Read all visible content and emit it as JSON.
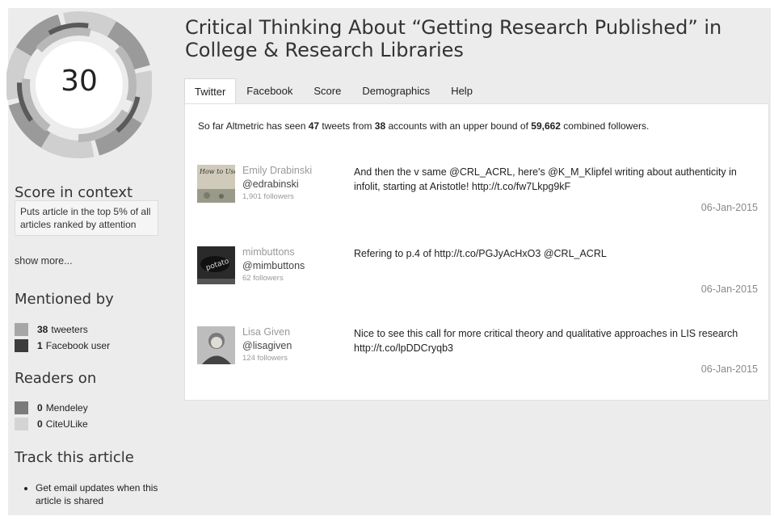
{
  "article": {
    "title": "Critical Thinking About “Getting Research Published” in College & Research Libraries"
  },
  "score": {
    "value": "30",
    "context_title": "Score in context",
    "context_text": "Puts article in the top 5% of all articles ranked by attention",
    "show_more": "show more..."
  },
  "mentioned_by": {
    "title": "Mentioned by",
    "items": [
      {
        "count": "38",
        "label": "tweeters",
        "color": "#a6a6a6"
      },
      {
        "count": "1",
        "label": "Facebook user",
        "color": "#3c3c3c"
      }
    ]
  },
  "readers_on": {
    "title": "Readers on",
    "items": [
      {
        "count": "0",
        "label": "Mendeley",
        "color": "#7a7a7a"
      },
      {
        "count": "0",
        "label": "CiteULike",
        "color": "#d4d4d4"
      }
    ]
  },
  "track": {
    "title": "Track this article",
    "items": [
      "Get email updates when this article is shared"
    ]
  },
  "tabs": [
    {
      "label": "Twitter",
      "active": true
    },
    {
      "label": "Facebook",
      "active": false
    },
    {
      "label": "Score",
      "active": false
    },
    {
      "label": "Demographics",
      "active": false
    },
    {
      "label": "Help",
      "active": false
    }
  ],
  "summary": {
    "prefix": "So far Altmetric has seen ",
    "tweets": "47",
    "mid1": " tweets from ",
    "accounts": "38",
    "mid2": " accounts with an upper bound of ",
    "followers": "59,662",
    "suffix": " combined followers."
  },
  "tweets": [
    {
      "name": "Emily Drabinski",
      "handle": "@edrabinski",
      "followers": "1,901 followers",
      "text": "And then the v same @CRL_ACRL, here's @K_M_Klipfel writing about authenticity in infolit, starting at Aristotle! http://t.co/fw7Lkpg9kF",
      "date": "06-Jan-2015",
      "avatar_text": "How to Use A Library"
    },
    {
      "name": "mimbuttons",
      "handle": "@mimbuttons",
      "followers": "62 followers",
      "text": "Refering to p.4 of http://t.co/PGJyAcHxO3 @CRL_ACRL",
      "date": "06-Jan-2015",
      "avatar_text": "potato"
    },
    {
      "name": "Lisa Given",
      "handle": "@lisagiven",
      "followers": "124 followers",
      "text": "Nice to see this call for more critical theory and qualitative approaches in LIS research http://t.co/lpDDCryqb3",
      "date": "06-Jan-2015",
      "avatar_text": ""
    }
  ]
}
